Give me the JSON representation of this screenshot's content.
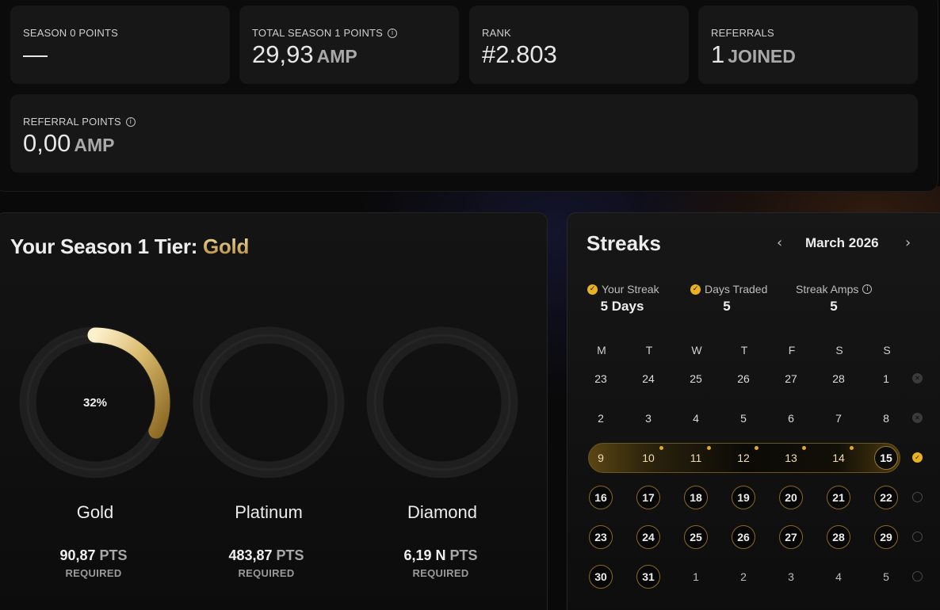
{
  "top_stats": [
    {
      "label": "SEASON 0 POINTS",
      "value": "—",
      "unit": "",
      "info": false
    },
    {
      "label": "TOTAL SEASON 1 POINTS",
      "value": "29,93",
      "unit": "AMP",
      "info": true
    },
    {
      "label": "RANK",
      "value": "#2.803",
      "unit": "",
      "info": false
    },
    {
      "label": "REFERRALS",
      "value": "1",
      "unit": "JOINED",
      "info": false
    }
  ],
  "referral_points": {
    "label": "REFERRAL POINTS",
    "value": "0,00",
    "unit": "AMP"
  },
  "tier": {
    "title_prefix": "Your Season 1 Tier:",
    "current": "Gold",
    "progress_label": "32%",
    "progress": 0.32,
    "tiers": [
      {
        "name": "Gold",
        "required_value": "90,87",
        "unit": "PTS",
        "required_label": "REQUIRED"
      },
      {
        "name": "Platinum",
        "required_value": "483,87",
        "unit": "PTS",
        "required_label": "REQUIRED"
      },
      {
        "name": "Diamond",
        "required_value": "6,19 N",
        "unit": "PTS",
        "required_label": "REQUIRED"
      }
    ]
  },
  "streaks": {
    "title": "Streaks",
    "month": "March 2026",
    "prev_icon": "chevron-left-icon",
    "next_icon": "chevron-right-icon",
    "stats": [
      {
        "label": "Your Streak",
        "value": "5 Days",
        "icon": "check-icon"
      },
      {
        "label": "Days Traded",
        "value": "5",
        "icon": "check-icon"
      },
      {
        "label": "Streak Amps",
        "value": "5",
        "icon": "info-icon"
      }
    ],
    "weekdays": [
      "M",
      "T",
      "W",
      "T",
      "F",
      "S",
      "S"
    ],
    "weeks": [
      {
        "days": [
          "23",
          "24",
          "25",
          "26",
          "27",
          "28",
          "1"
        ],
        "status": "missed"
      },
      {
        "days": [
          "2",
          "3",
          "4",
          "5",
          "6",
          "7",
          "8"
        ],
        "status": "missed"
      },
      {
        "days": [
          "9",
          "10",
          "11",
          "12",
          "13",
          "14",
          "15"
        ],
        "status": "completed"
      },
      {
        "days": [
          "16",
          "17",
          "18",
          "19",
          "20",
          "21",
          "22"
        ],
        "status": "pending"
      },
      {
        "days": [
          "23",
          "24",
          "25",
          "26",
          "27",
          "28",
          "29"
        ],
        "status": "pending"
      },
      {
        "days": [
          "30",
          "31",
          "1",
          "2",
          "3",
          "4",
          "5"
        ],
        "status": "pending"
      }
    ],
    "accent": "#e9b21f"
  }
}
